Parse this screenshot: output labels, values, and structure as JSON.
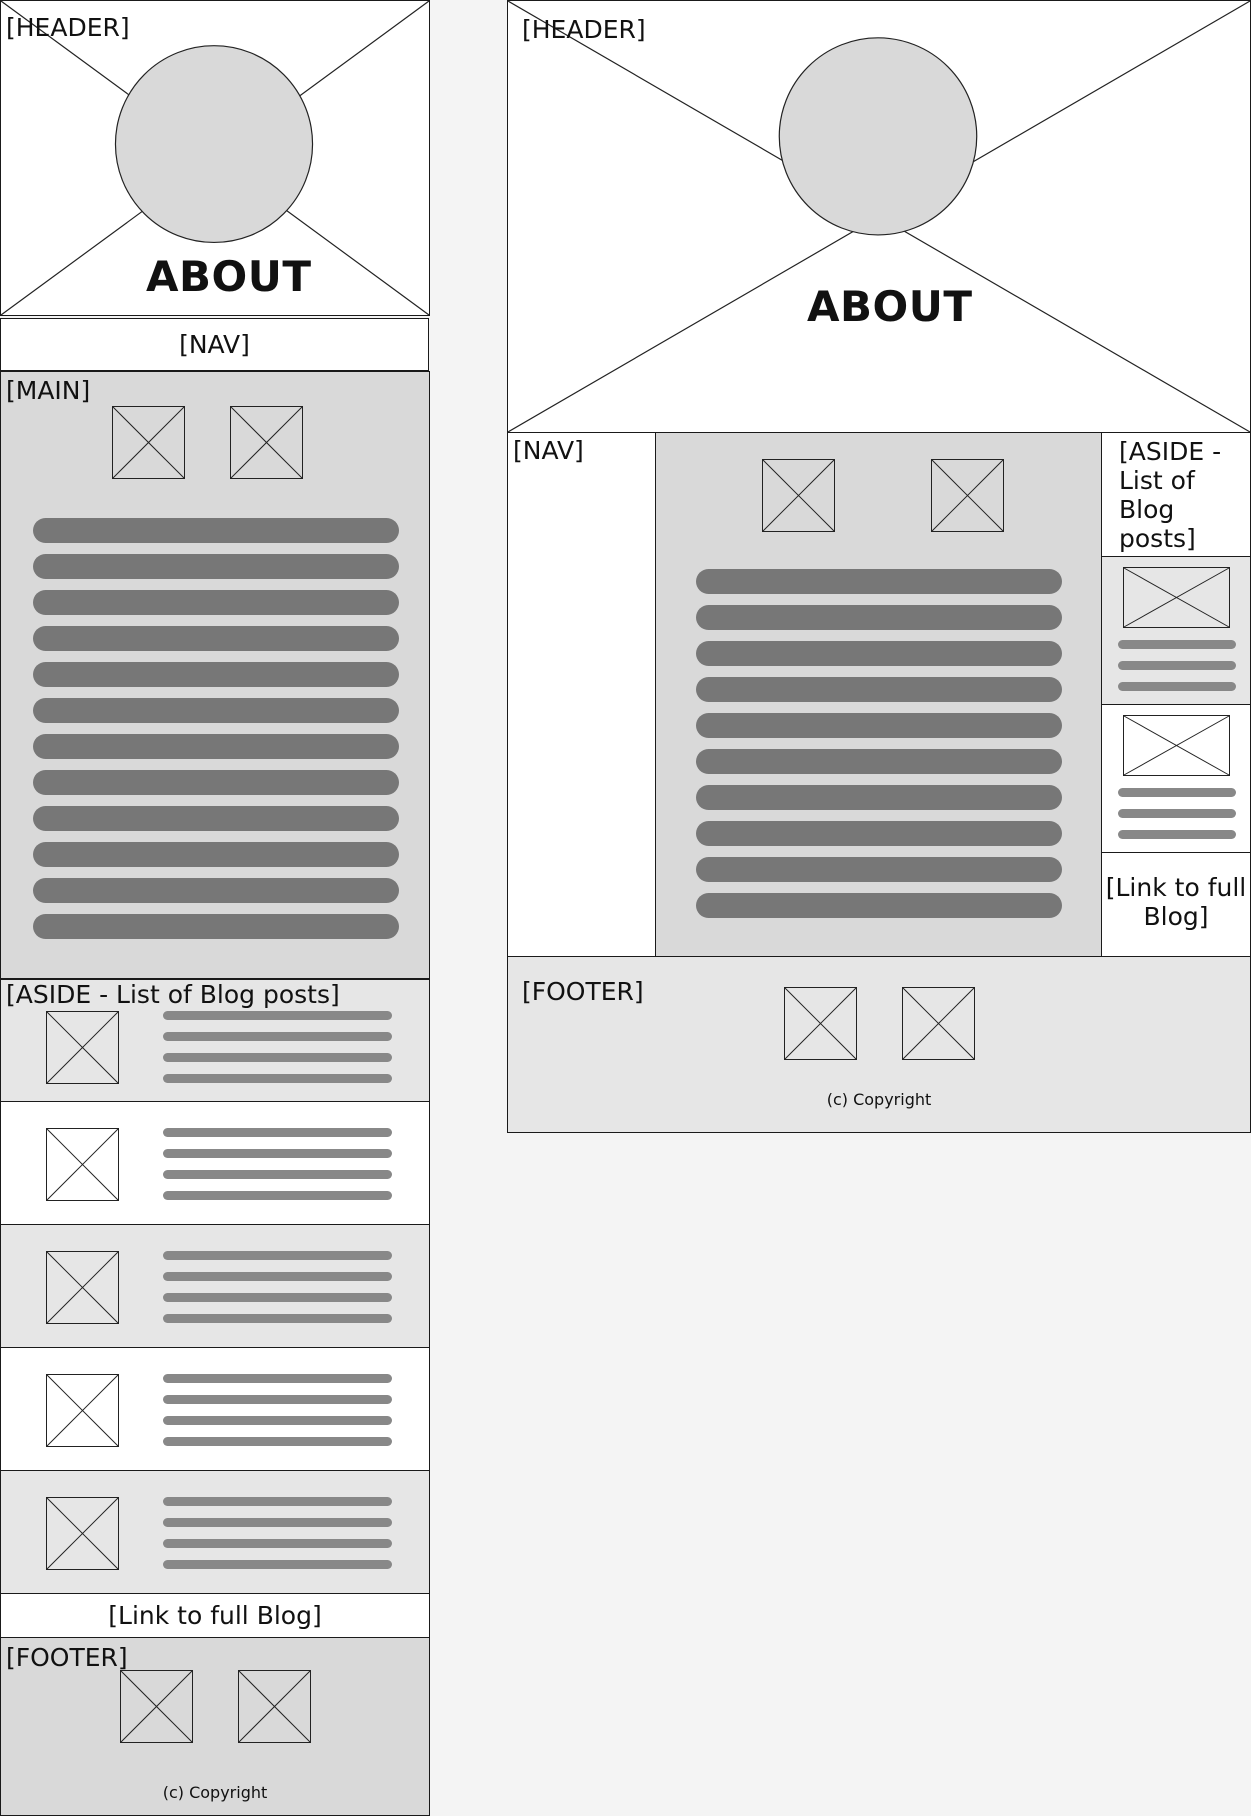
{
  "mobile": {
    "header": {
      "label": "[HEADER]",
      "title": "ABOUT"
    },
    "nav": {
      "label": "[NAV]"
    },
    "main": {
      "label": "[MAIN]"
    },
    "aside": {
      "label": "[ASIDE - List of Blog posts]"
    },
    "blog_link": {
      "label": "[Link to full Blog]"
    },
    "footer": {
      "label": "[FOOTER]",
      "copyright": "(c) Copyright"
    }
  },
  "desktop": {
    "header": {
      "label": "[HEADER]",
      "title": "ABOUT"
    },
    "nav": {
      "label": "[NAV]"
    },
    "aside": {
      "label_lines": [
        "[ASIDE -",
        "List of",
        "Blog",
        "posts]"
      ]
    },
    "blog_link": {
      "label_lines": [
        "[Link to full",
        "Blog]"
      ]
    },
    "footer": {
      "label": "[FOOTER]",
      "copyright": "(c) Copyright"
    }
  },
  "colors": {
    "canvas": "#f4f4f4",
    "panel_light": "#e6e6e6",
    "panel_mid": "#d9d9d9",
    "circle": "#d9d9d9",
    "text_bar": "#777777",
    "outline": "#1a1a1a"
  }
}
